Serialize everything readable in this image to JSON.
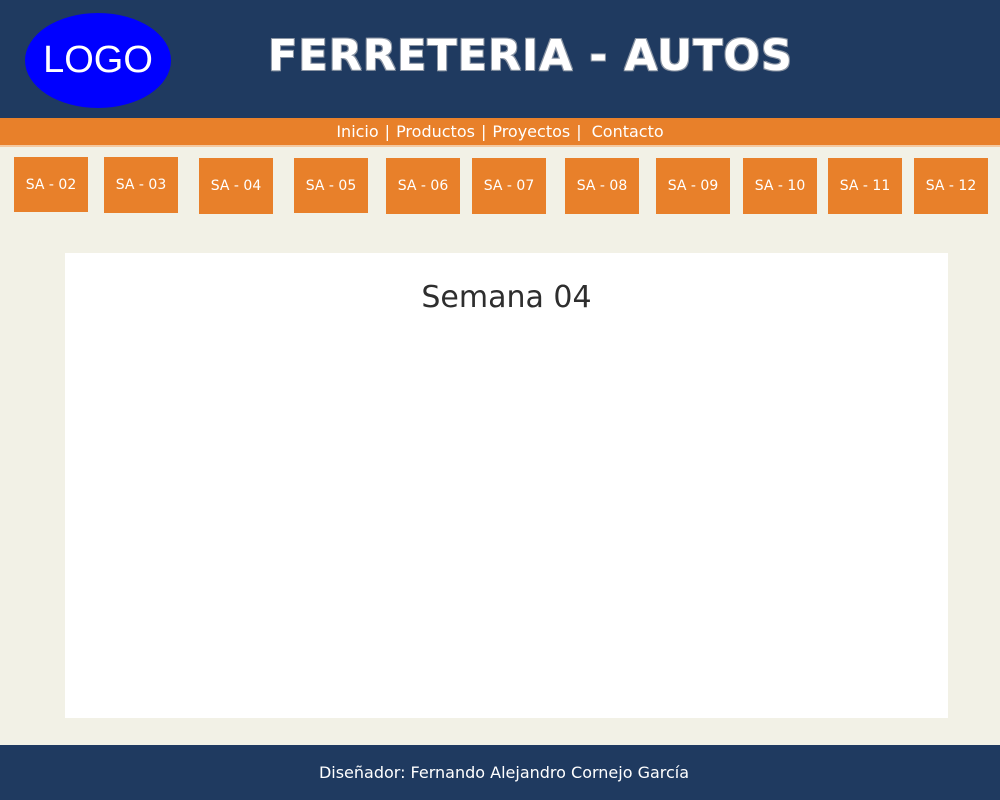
{
  "header": {
    "logo_text": "LOGO",
    "title": "FERRETERIA - AUTOS"
  },
  "nav": {
    "items": [
      {
        "label": "Inicio"
      },
      {
        "label": "Productos"
      },
      {
        "label": "Proyectos"
      },
      {
        "label": "Contacto"
      }
    ],
    "separator": "|"
  },
  "weeks": {
    "buttons": [
      {
        "label": "SA - 02"
      },
      {
        "label": "SA - 03"
      },
      {
        "label": "SA - 04"
      },
      {
        "label": "SA - 05"
      },
      {
        "label": "SA - 06"
      },
      {
        "label": "SA - 07"
      },
      {
        "label": "SA - 08"
      },
      {
        "label": "SA - 09"
      },
      {
        "label": "SA - 10"
      },
      {
        "label": "SA - 11"
      },
      {
        "label": "SA - 12"
      }
    ]
  },
  "main": {
    "title": "Semana 04"
  },
  "footer": {
    "text": "Diseñador: Fernando Alejandro Cornejo García"
  },
  "colors": {
    "header_bg": "#1f3a60",
    "accent_orange": "#e8802a",
    "logo_blue": "#0000ff",
    "page_bg": "#f2f1e6"
  }
}
